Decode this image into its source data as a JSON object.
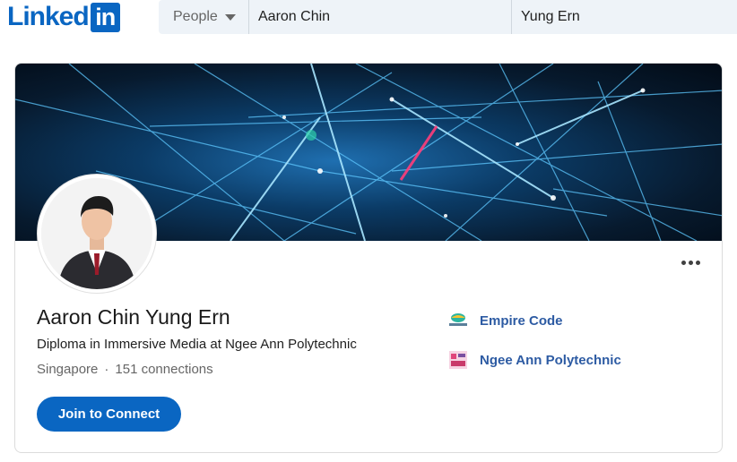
{
  "header": {
    "logo_text": "Linked",
    "logo_box": "in",
    "search_category": "People",
    "first_name_value": "Aaron Chin",
    "last_name_value": "Yung Ern"
  },
  "profile": {
    "name": "Aaron Chin Yung Ern",
    "headline": "Diploma in Immersive Media at Ngee Ann Polytechnic",
    "location": "Singapore",
    "separator": "·",
    "connections": "151 connections",
    "connect_button": "Join to Connect"
  },
  "organizations": [
    {
      "name": "Empire Code",
      "icon": "empire-code-logo-icon"
    },
    {
      "name": "Ngee Ann Polytechnic",
      "icon": "ngee-ann-polytechnic-logo-icon"
    }
  ],
  "colors": {
    "brand": "#0a66c2",
    "org_link": "#2d5ba3"
  }
}
